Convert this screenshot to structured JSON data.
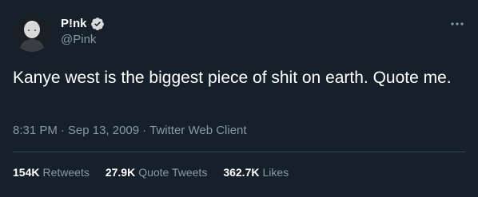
{
  "author": {
    "display_name": "P!nk",
    "handle": "@Pink",
    "verified": true,
    "avatar_icon": "avatar-photo"
  },
  "tweet": {
    "text": "Kanye west is the biggest piece of shit on earth. Quote me.",
    "time": "8:31 PM",
    "date": "Sep 13, 2009",
    "separator": "·",
    "source": "Twitter Web Client"
  },
  "stats": {
    "retweets_value": "154K",
    "retweets_label": "Retweets",
    "quote_tweets_value": "27.9K",
    "quote_tweets_label": "Quote Tweets",
    "likes_value": "362.7K",
    "likes_label": "Likes"
  },
  "colors": {
    "background": "#15202b",
    "primary_text": "#ffffff",
    "secondary_text": "#8b98a5",
    "divider": "#38444d",
    "verified_badge": "#d9d9d9"
  }
}
